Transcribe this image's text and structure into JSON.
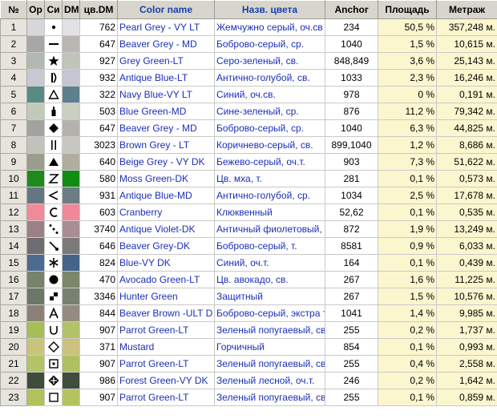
{
  "headers": {
    "num": "№",
    "orig": "Ор",
    "sym": "Си",
    "dmcol": "DM",
    "code": "цв.DM",
    "color_name": "Color name",
    "ru_name": "Назв. цвета",
    "anchor": "Anchor",
    "area": "Площадь",
    "length": "Метраж"
  },
  "rows": [
    {
      "n": "1",
      "orig": "#d7d6da",
      "dm": "#e2e2e4",
      "sym": "dot",
      "code": "762",
      "en": "Pearl Grey - VY LT",
      "ru": "Жемчужно серый, оч.св",
      "anchor": "234",
      "area": "50,5 %",
      "len": "357,248 м."
    },
    {
      "n": "2",
      "orig": "#a9a6a6",
      "dm": "#b9b7b4",
      "sym": "dash",
      "code": "647",
      "en": "Beaver Grey - MD",
      "ru": "Боброво-серый, ср.",
      "anchor": "1040",
      "area": "1,5 %",
      "len": "10,615 м."
    },
    {
      "n": "3",
      "orig": "#b4b8b2",
      "dm": "#c0c4bb",
      "sym": "star",
      "code": "927",
      "en": "Grey Green-LT",
      "ru": "Серо-зеленый, св.",
      "anchor": "848,849",
      "area": "3,6 %",
      "len": "25,143 м."
    },
    {
      "n": "4",
      "orig": "#c7c9d3",
      "dm": "#c4c7d2",
      "sym": "ibar",
      "code": "932",
      "en": "Antique Blue-LT",
      "ru": "Антично-голубой, св.",
      "anchor": "1033",
      "area": "2,3 %",
      "len": "16,246 м."
    },
    {
      "n": "5",
      "orig": "#5a8a84",
      "dm": "#5e7f8e",
      "sym": "triangle-outline",
      "code": "322",
      "en": "Navy Blue-VY LT",
      "ru": "Синий, оч.св.",
      "anchor": "978",
      "area": "0 %",
      "len": "0,191 м."
    },
    {
      "n": "6",
      "orig": "#c1c9b8",
      "dm": "#c9d0bf",
      "sym": "bottle",
      "code": "503",
      "en": "Blue Green-MD",
      "ru": "Сине-зеленый, ср.",
      "anchor": "876",
      "area": "11,2 %",
      "len": "79,342 м."
    },
    {
      "n": "7",
      "orig": "#a4a29f",
      "dm": "#b5b2ad",
      "sym": "diamond",
      "code": "647",
      "en": "Beaver Grey - MD",
      "ru": "Боброво-серый, ср.",
      "anchor": "1040",
      "area": "6,3 %",
      "len": "44,825 м."
    },
    {
      "n": "8",
      "orig": "#c2c2bc",
      "dm": "#c8c6c0",
      "sym": "double-bar",
      "code": "3023",
      "en": "Brown Grey - LT",
      "ru": "Коричнево-серый, св.",
      "anchor": "899,1040",
      "area": "1,2 %",
      "len": "8,686 м."
    },
    {
      "n": "9",
      "orig": "#9a9c8c",
      "dm": "#b0ad9f",
      "sym": "triangle",
      "code": "640",
      "en": "Beige Grey - VY DK",
      "ru": "Бежево-серый, оч.т.",
      "anchor": "903",
      "area": "7,3 %",
      "len": "51,622 м."
    },
    {
      "n": "10",
      "orig": "#1f8a1c",
      "dm": "#138c14",
      "sym": "z",
      "code": "580",
      "en": "Moss Green-DK",
      "ru": "Цв. мха, т.",
      "anchor": "281",
      "area": "0,1 %",
      "len": "0,573 м."
    },
    {
      "n": "11",
      "orig": "#667680",
      "dm": "#6d7c85",
      "sym": "less-than",
      "code": "931",
      "en": "Antique Blue-MD",
      "ru": "Антично-голубой, ср.",
      "anchor": "1034",
      "area": "2,5 %",
      "len": "17,678 м."
    },
    {
      "n": "12",
      "orig": "#f08a98",
      "dm": "#f0889a",
      "sym": "c",
      "code": "603",
      "en": "Cranberry",
      "ru": "Клюквенный",
      "anchor": "52,62",
      "area": "0,1 %",
      "len": "0,535 м."
    },
    {
      "n": "13",
      "orig": "#9c8086",
      "dm": "#a98d92",
      "sym": "dots3",
      "code": "3740",
      "en": "Antique Violet-DK",
      "ru": "Античный фиолетовый, т",
      "anchor": "872",
      "area": "1,9 %",
      "len": "13,249 м."
    },
    {
      "n": "14",
      "orig": "#6e6e72",
      "dm": "#7b7a78",
      "sym": "slash-dot",
      "code": "646",
      "en": "Beaver Grey-DK",
      "ru": "Боброво-серый, т.",
      "anchor": "8581",
      "area": "0,9 %",
      "len": "6,033 м."
    },
    {
      "n": "15",
      "orig": "#4d6a90",
      "dm": "#45628a",
      "sym": "asterisk",
      "code": "824",
      "en": "Blue-VY DK",
      "ru": "Синий, оч.т.",
      "anchor": "164",
      "area": "0,1 %",
      "len": "0,439 м."
    },
    {
      "n": "16",
      "orig": "#77836b",
      "dm": "#7c8769",
      "sym": "circle",
      "code": "470",
      "en": "Avocado Green-LT",
      "ru": "Цв. авокадо, св.",
      "anchor": "267",
      "area": "1,6 %",
      "len": "11,225 м."
    },
    {
      "n": "17",
      "orig": "#6b7868",
      "dm": "#778170",
      "sym": "checker",
      "code": "3346",
      "en": "Hunter Green",
      "ru": "Защитный",
      "anchor": "267",
      "area": "1,5 %",
      "len": "10,576 м."
    },
    {
      "n": "18",
      "orig": "#8c8078",
      "dm": "#948b82",
      "sym": "a",
      "code": "844",
      "en": "Beaver Brown -ULT D",
      "ru": "Боброво-серый, экстра т",
      "anchor": "1041",
      "area": "1,4 %",
      "len": "9,985 м."
    },
    {
      "n": "19",
      "orig": "#a6be57",
      "dm": "#b2c269",
      "sym": "u",
      "code": "907",
      "en": "Parrot Green-LT",
      "ru": "Зеленый попугаевый, св",
      "anchor": "255",
      "area": "0,2 %",
      "len": "1,737 м."
    },
    {
      "n": "20",
      "orig": "#c8c47a",
      "dm": "#cdc27d",
      "sym": "diamond-outline",
      "code": "371",
      "en": "Mustard",
      "ru": "Горчичный",
      "anchor": "854",
      "area": "0,1 %",
      "len": "0,993 м."
    },
    {
      "n": "21",
      "orig": "#b2c466",
      "dm": "#aec060",
      "sym": "square-dot",
      "code": "907",
      "en": "Parrot Green-LT",
      "ru": "Зеленый попугаевый, св",
      "anchor": "255",
      "area": "0,4 %",
      "len": "2,558 м."
    },
    {
      "n": "22",
      "orig": "#3d4c3b",
      "dm": "#404d3c",
      "sym": "plus-diamond",
      "code": "986",
      "en": "Forest Green-VY DK",
      "ru": "Зеленый лесной, оч.т.",
      "anchor": "246",
      "area": "0,2 %",
      "len": "1,642 м."
    },
    {
      "n": "23",
      "orig": "#b3c15a",
      "dm": "#b4c35f",
      "sym": "square-outline",
      "code": "907",
      "en": "Parrot Green-LT",
      "ru": "Зеленый попугаевый, св",
      "anchor": "255",
      "area": "0,1 %",
      "len": "0,859 м."
    }
  ]
}
